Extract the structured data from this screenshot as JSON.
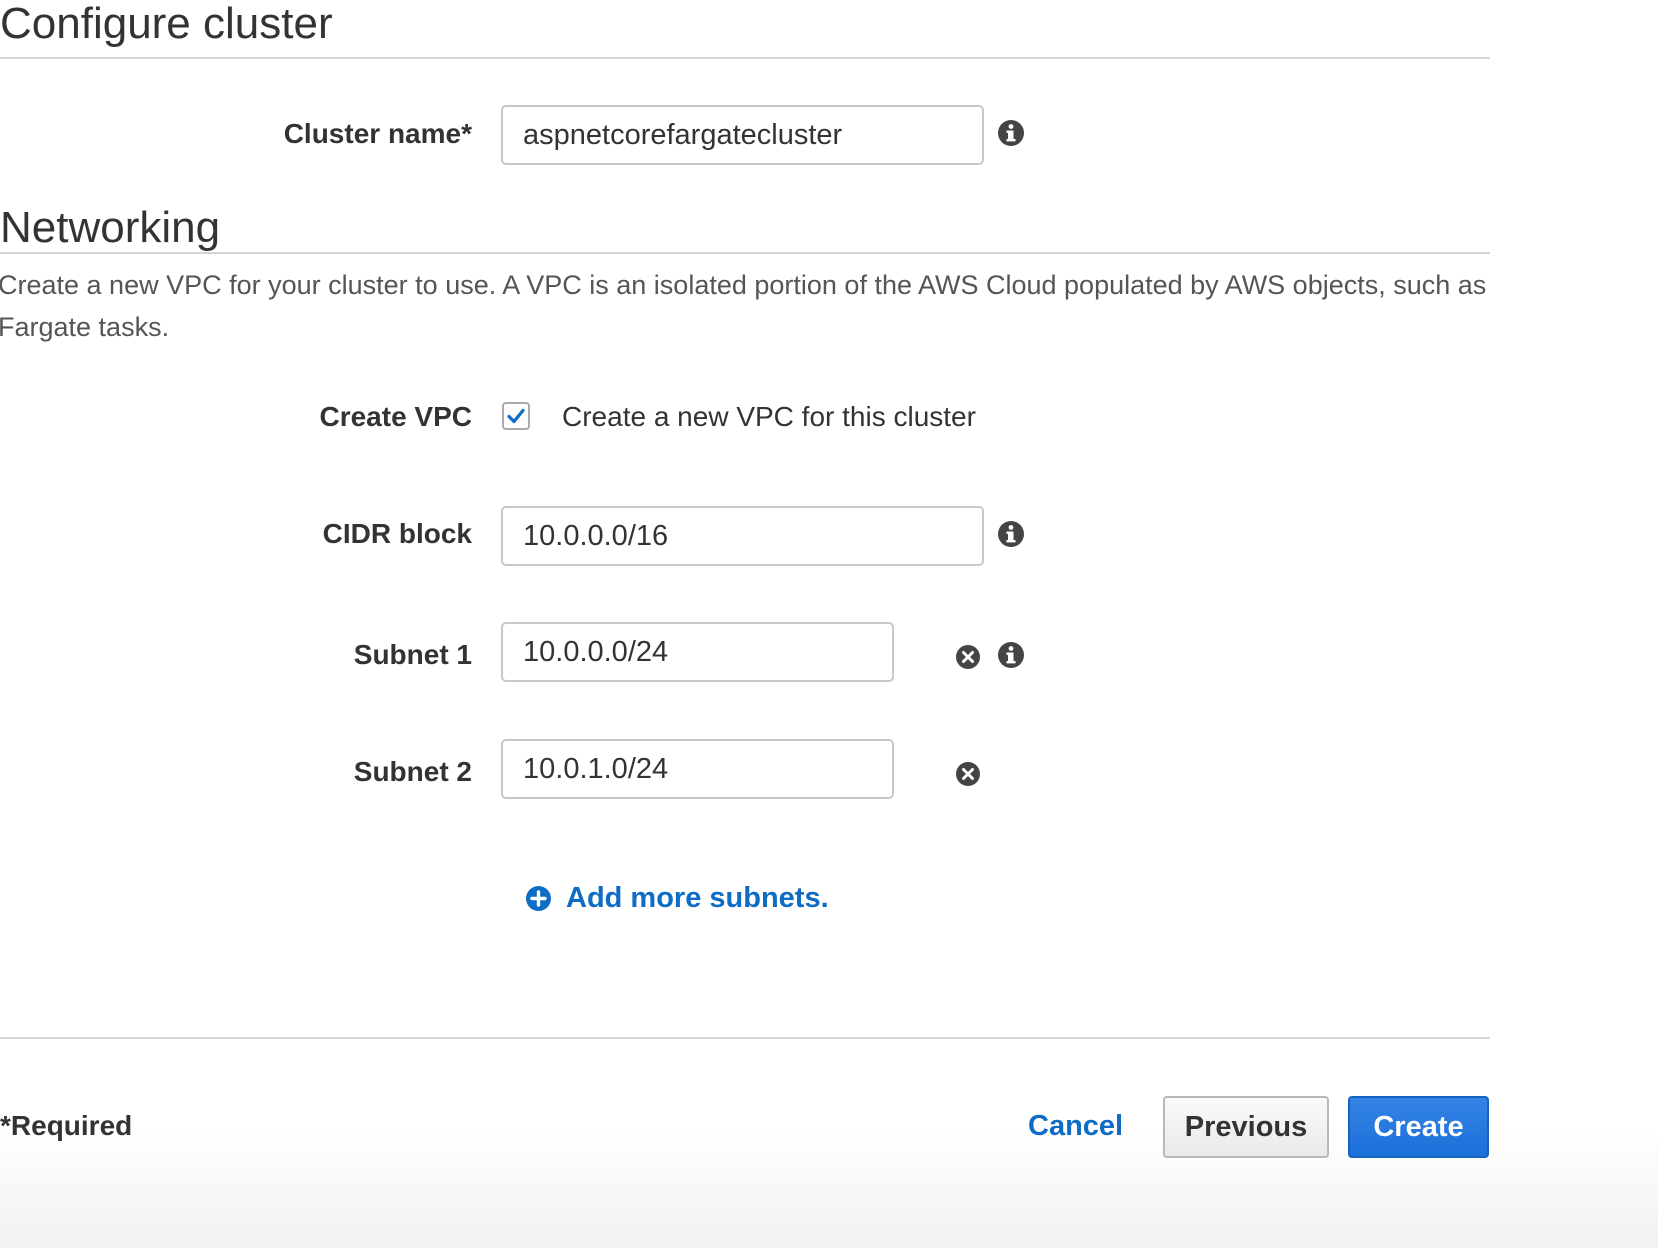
{
  "header": {
    "title": "Configure cluster"
  },
  "cluster": {
    "name_label": "Cluster name*",
    "name_value": "aspnetcorefargatecluster"
  },
  "networking": {
    "title": "Networking",
    "description": "Create a new VPC for your cluster to use. A VPC is an isolated portion of the AWS Cloud populated by AWS objects, such as Fargate tasks.",
    "create_vpc_label": "Create VPC",
    "create_vpc_checked": true,
    "create_vpc_text": "Create a new VPC for this cluster",
    "cidr_label": "CIDR block",
    "cidr_value": "10.0.0.0/16",
    "subnets": [
      {
        "label": "Subnet 1",
        "value": "10.0.0.0/24"
      },
      {
        "label": "Subnet 2",
        "value": "10.0.1.0/24"
      }
    ],
    "add_subnets_label": "Add more subnets."
  },
  "footer": {
    "required_note": "*Required",
    "cancel_label": "Cancel",
    "previous_label": "Previous",
    "create_label": "Create"
  },
  "colors": {
    "accent": "#0e6cc4",
    "primary_button": "#1c6fd9",
    "icon": "#444444",
    "rule": "#d5d5d5"
  },
  "icons": {
    "info": "info-icon",
    "remove": "remove-circle-icon",
    "add": "plus-circle-icon",
    "check": "check-icon"
  }
}
